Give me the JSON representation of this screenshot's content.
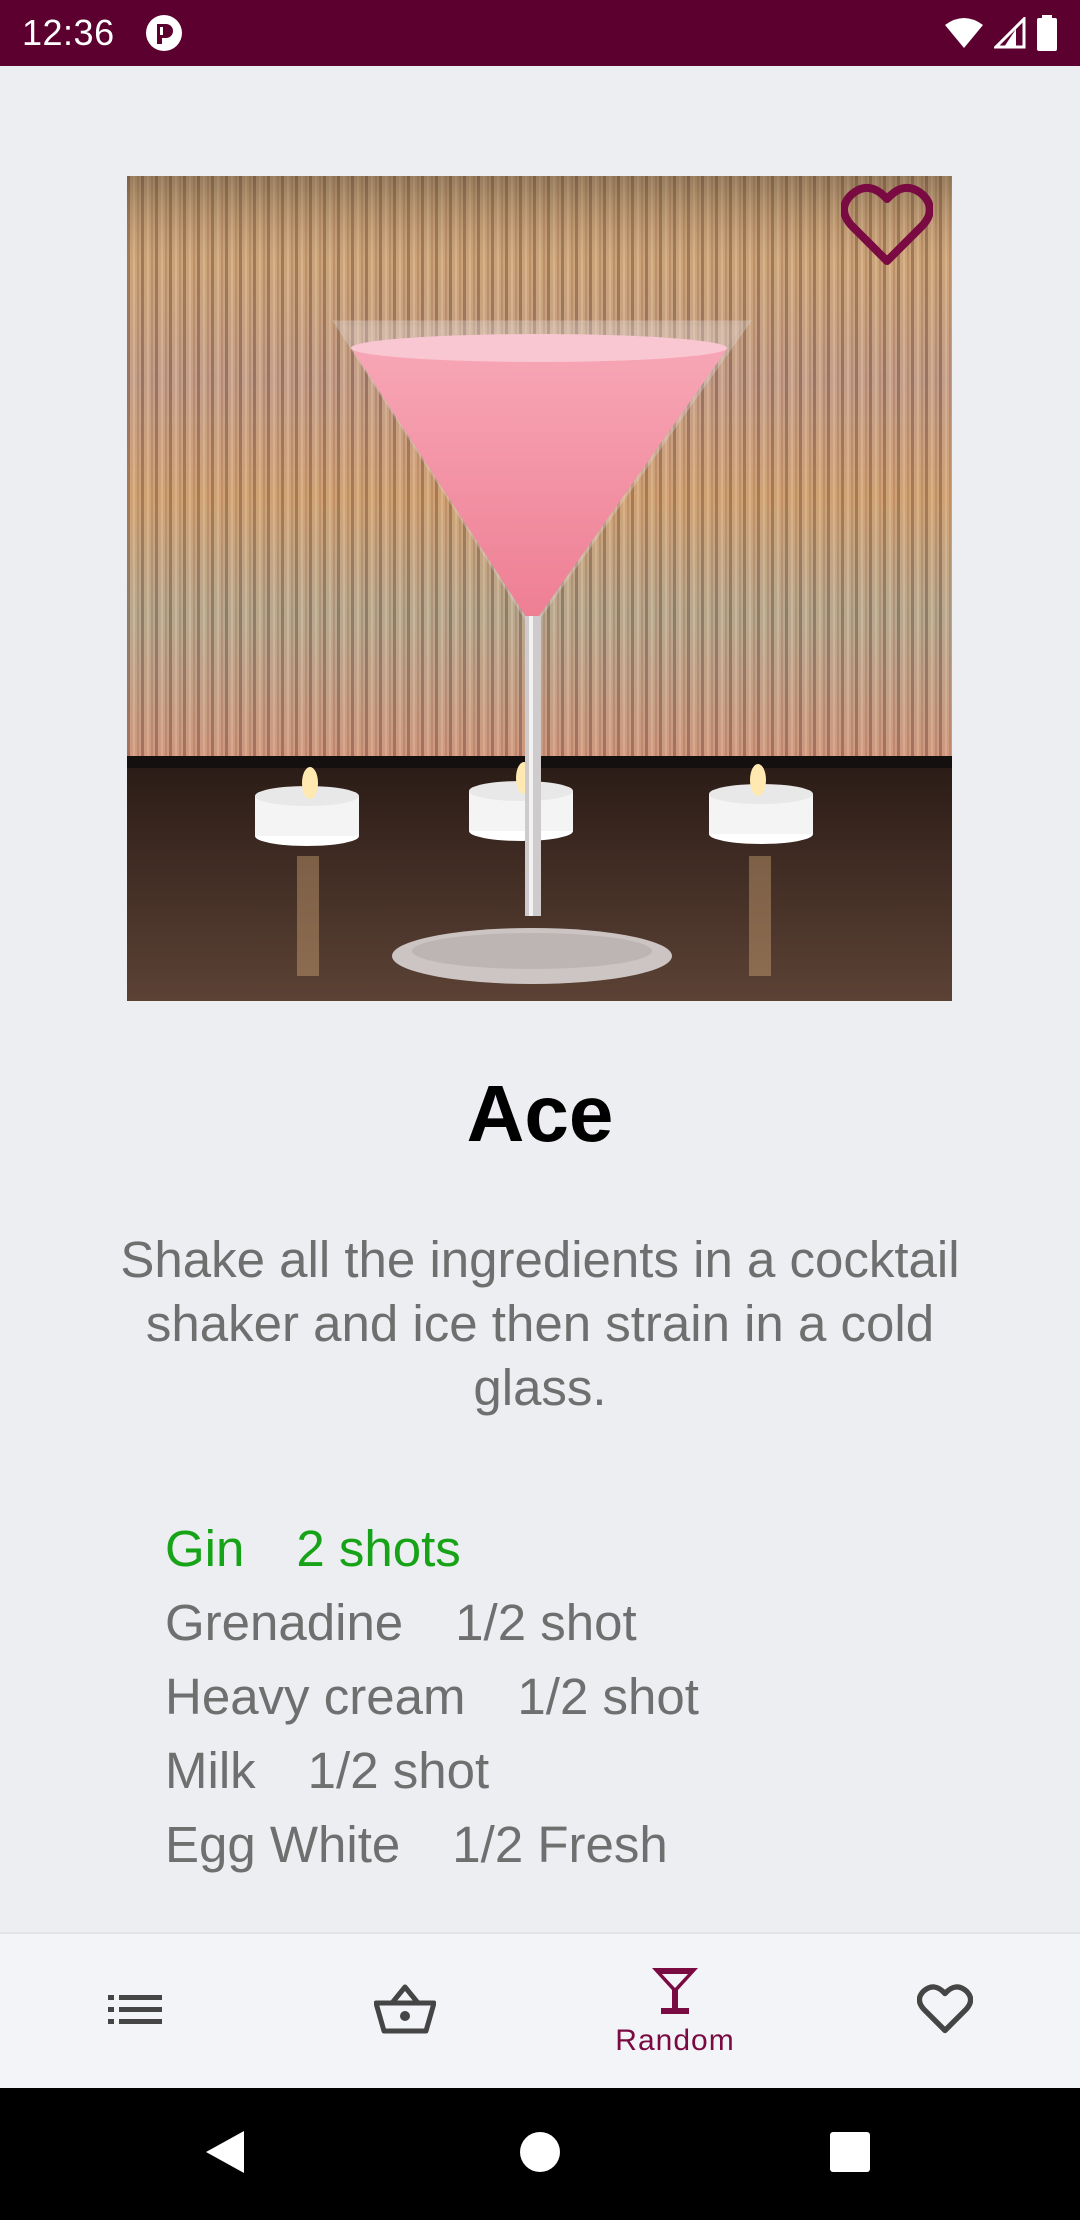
{
  "status_bar": {
    "time": "12:36",
    "icons": [
      "app-notification-icon",
      "wifi-icon",
      "signal-icon",
      "battery-icon"
    ]
  },
  "drink": {
    "name": "Ace",
    "instructions": "Shake all the ingredients in a cocktail shaker and ice then strain in a cold glass.",
    "favorite": false,
    "ingredients": [
      {
        "name": "Gin",
        "amount": "2 shots",
        "available": true
      },
      {
        "name": "Grenadine",
        "amount": "1/2 shot",
        "available": false
      },
      {
        "name": "Heavy cream",
        "amount": "1/2 shot",
        "available": false
      },
      {
        "name": "Milk",
        "amount": "1/2 shot",
        "available": false
      },
      {
        "name": "Egg White",
        "amount": "1/2 Fresh",
        "available": false
      }
    ]
  },
  "bottom_nav": {
    "items": [
      {
        "icon": "list-icon",
        "label": "",
        "active": false
      },
      {
        "icon": "basket-icon",
        "label": "",
        "active": false
      },
      {
        "icon": "cocktail-glass-icon",
        "label": "Random",
        "active": true
      },
      {
        "icon": "heart-icon",
        "label": "",
        "active": false
      }
    ]
  },
  "colors": {
    "status_bar": "#5C0030",
    "accent": "#7A0A42",
    "available_ingredient": "#17A317",
    "text_secondary": "#6F6F6F",
    "background": "#ECEEF1"
  }
}
